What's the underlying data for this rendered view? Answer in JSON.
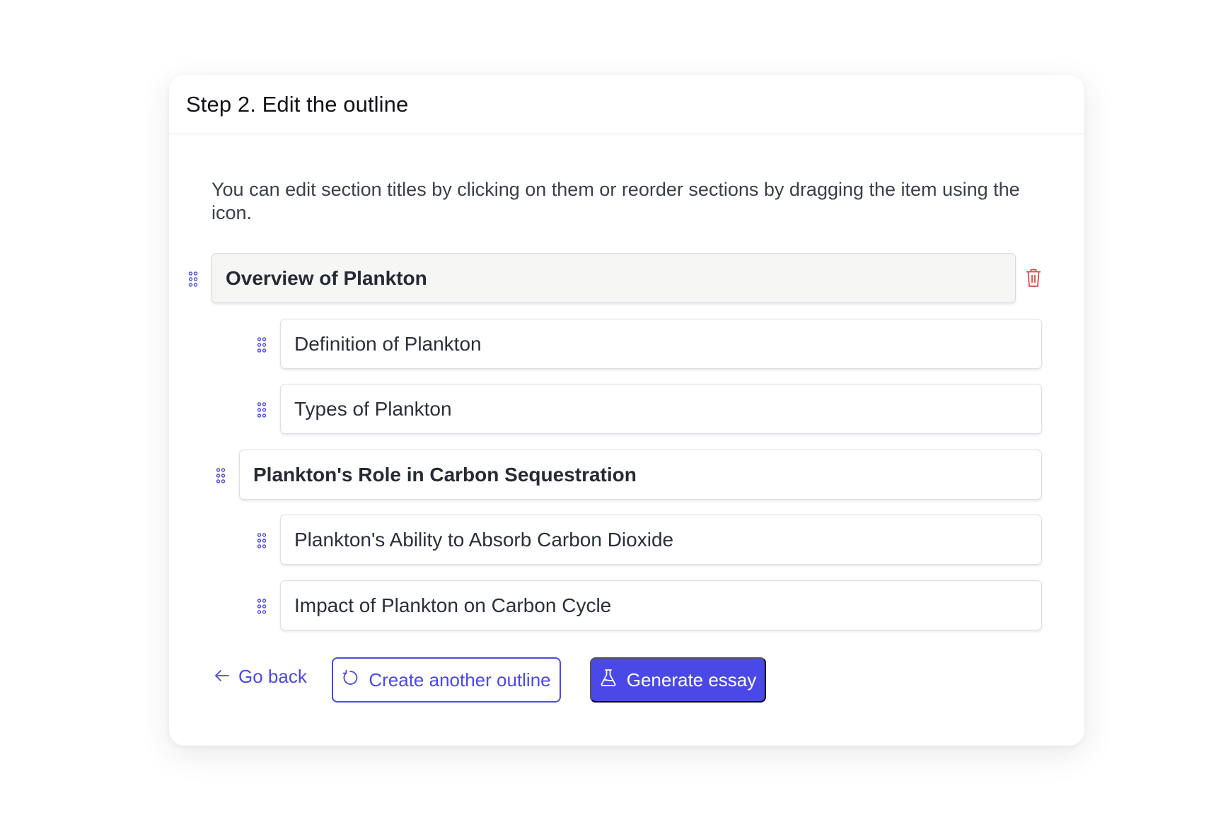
{
  "header": {
    "title": "Step 2. Edit the outline"
  },
  "hint": "You can edit section titles by clicking on them or reorder sections by dragging the item using the icon.",
  "outline": [
    {
      "level": "section",
      "title": "Overview of Plankton"
    },
    {
      "level": "subsection",
      "title": "Definition of Plankton"
    },
    {
      "level": "subsection",
      "title": "Types of Plankton"
    },
    {
      "level": "section",
      "title": "Plankton's Role in Carbon Sequestration"
    },
    {
      "level": "subsection",
      "title": "Plankton's Ability to Absorb Carbon Dioxide"
    },
    {
      "level": "subsection",
      "title": "Impact of Plankton on Carbon Cycle"
    }
  ],
  "actions": {
    "back_label": "Go back",
    "regenerate_label": "Create another outline",
    "generate_label": "Generate essay"
  },
  "colors": {
    "accent": "#4b48e8",
    "delete": "#e04848",
    "active_row_bg": "#f6f6f5"
  },
  "icons": {
    "drag": "drag-handle-icon",
    "delete": "trash-icon",
    "back": "arrow-left-icon",
    "regenerate": "refresh-icon",
    "generate": "flask-icon"
  }
}
